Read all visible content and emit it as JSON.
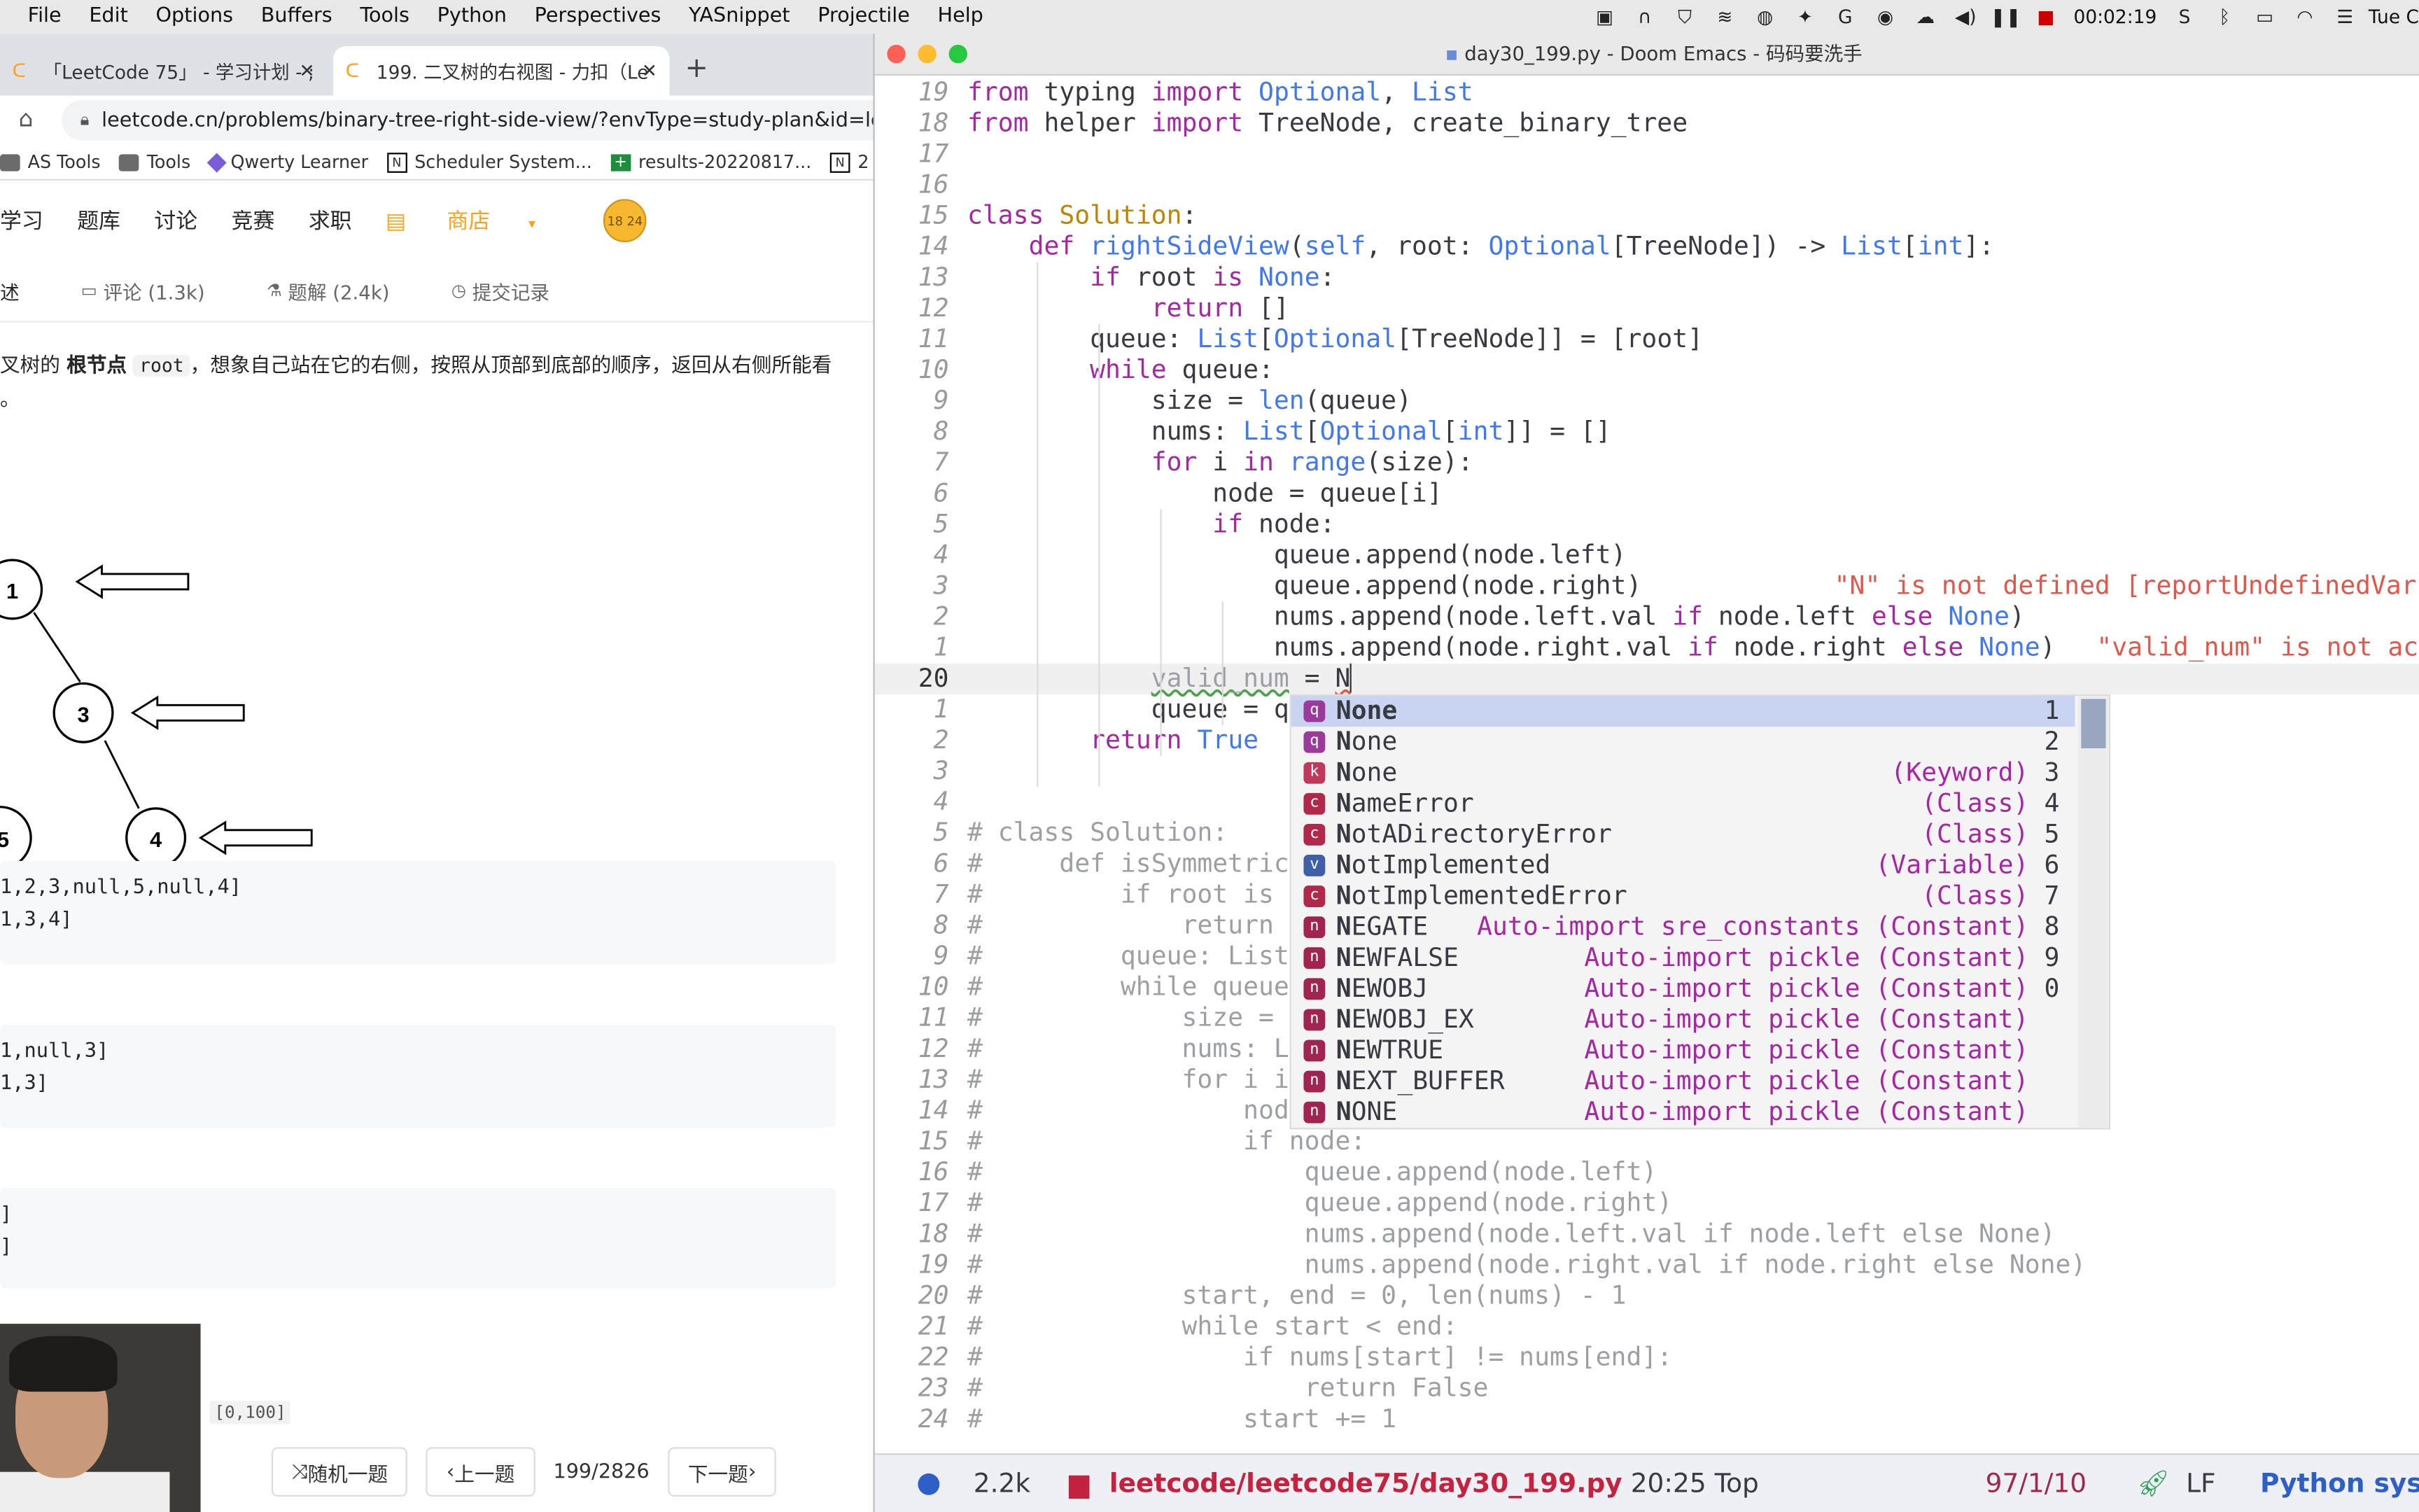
{
  "menubar": {
    "items": [
      "File",
      "Edit",
      "Options",
      "Buffers",
      "Tools",
      "Python",
      "Perspectives",
      "YASnippet",
      "Projectile",
      "Help"
    ],
    "timer": "00:02:19",
    "date": "Tue C"
  },
  "browser": {
    "tabs": [
      {
        "title": "「LeetCode 75」 - 学习计划 - ;"
      },
      {
        "title": "199. 二叉树的右视图 - 力扣（Le"
      }
    ],
    "url": "leetcode.cn/problems/binary-tree-right-side-view/?envType=study-plan&id=leetco",
    "bookmarks": [
      "AS Tools",
      "Tools",
      "Qwerty Learner",
      "Scheduler System...",
      "results-20220817...",
      "2"
    ],
    "nav": [
      "学习",
      "题库",
      "讨论",
      "竞赛",
      "求职",
      "商店"
    ],
    "coin_text": "18 24",
    "subtabs": [
      "述",
      "评论 (1.3k)",
      "题解 (2.4k)",
      "提交记录"
    ],
    "description": {
      "part1": "叉树的 ",
      "bold": "根节点",
      "code": "root",
      "part2": "，想象自己站在它的右侧，按照从顶部到底部的顺序，返回从右侧所能看",
      "part3": "。"
    },
    "tree_nodes": [
      "1",
      "3",
      "5",
      "4"
    ],
    "examples": [
      [
        "1,2,3,null,5,null,4]",
        "1,3,4]"
      ],
      [
        "1,null,3]",
        "1,3]"
      ],
      [
        "]",
        "]"
      ]
    ],
    "range": "[0,100]",
    "buttons": {
      "random": "随机一题",
      "prev": "上一题",
      "page": "199/2826",
      "next": "下一题"
    }
  },
  "emacs": {
    "title": "day30_199.py - Doom Emacs - 码码要洗手",
    "lines": [
      {
        "n": "19",
        "c": "from typing import Optional, List"
      },
      {
        "n": "18",
        "c": "from helper import TreeNode, create_binary_tree"
      },
      {
        "n": "17",
        "c": ""
      },
      {
        "n": "16",
        "c": ""
      },
      {
        "n": "15",
        "c": "class Solution:"
      },
      {
        "n": "14",
        "c": "    def rightSideView(self, root: Optional[TreeNode]) -> List[int]:"
      },
      {
        "n": "13",
        "c": "        if root is None:"
      },
      {
        "n": "12",
        "c": "            return []"
      },
      {
        "n": "11",
        "c": "        queue: List[Optional[TreeNode]] = [root]"
      },
      {
        "n": "10",
        "c": "        while queue:"
      },
      {
        "n": "9",
        "c": "            size = len(queue)"
      },
      {
        "n": "8",
        "c": "            nums: List[Optional[int]] = []"
      },
      {
        "n": "7",
        "c": "            for i in range(size):"
      },
      {
        "n": "6",
        "c": "                node = queue[i]"
      },
      {
        "n": "5",
        "c": "                if node:"
      },
      {
        "n": "4",
        "c": "                    queue.append(node.left)"
      },
      {
        "n": "3",
        "c": "                    queue.append(node.right)"
      },
      {
        "n": "2",
        "c": "                    nums.append(node.left.val if node.left else None)"
      },
      {
        "n": "1",
        "c": "                    nums.append(node.right.val if node.right else None)"
      },
      {
        "n": "20",
        "c": "            valid_num = N"
      },
      {
        "n": "1",
        "c": "            queue = q"
      },
      {
        "n": "2",
        "c": "        return True"
      },
      {
        "n": "3",
        "c": ""
      },
      {
        "n": "4",
        "c": ""
      },
      {
        "n": "5",
        "c": "# class Solution:"
      },
      {
        "n": "6",
        "c": "#     def isSymmetric"
      },
      {
        "n": "7",
        "c": "#         if root is"
      },
      {
        "n": "8",
        "c": "#             return"
      },
      {
        "n": "9",
        "c": "#         queue: List"
      },
      {
        "n": "10",
        "c": "#         while queue"
      },
      {
        "n": "11",
        "c": "#             size ="
      },
      {
        "n": "12",
        "c": "#             nums: L"
      },
      {
        "n": "13",
        "c": "#             for i i"
      },
      {
        "n": "14",
        "c": "#                 nod"
      },
      {
        "n": "15",
        "c": "#                 if node:"
      },
      {
        "n": "16",
        "c": "#                     queue.append(node.left)"
      },
      {
        "n": "17",
        "c": "#                     queue.append(node.right)"
      },
      {
        "n": "18",
        "c": "#                     nums.append(node.left.val if node.left else None)"
      },
      {
        "n": "19",
        "c": "#                     nums.append(node.right.val if node.right else None)"
      },
      {
        "n": "20",
        "c": "#             start, end = 0, len(nums) - 1"
      },
      {
        "n": "21",
        "c": "#             while start < end:"
      },
      {
        "n": "22",
        "c": "#                 if nums[start] != nums[end]:"
      },
      {
        "n": "23",
        "c": "#                     return False"
      },
      {
        "n": "24",
        "c": "#                 start += 1"
      }
    ],
    "diagnostics": [
      "\"N\" is not defined [reportUndefinedVar",
      "\"valid_num\" is not ac"
    ],
    "completions": [
      {
        "first": "N",
        "rest": "one",
        "detail": "",
        "num": "1",
        "icon": "q",
        "color": "#9b3a9b"
      },
      {
        "first": "N",
        "rest": "one",
        "detail": "",
        "num": "2",
        "icon": "q",
        "color": "#9b3a9b"
      },
      {
        "first": "N",
        "rest": "one",
        "detail": "(Keyword)",
        "num": "3",
        "icon": "k",
        "color": "#c0395c"
      },
      {
        "first": "N",
        "rest": "ameError",
        "detail": "(Class)",
        "num": "4",
        "icon": "c",
        "color": "#b0284a"
      },
      {
        "first": "N",
        "rest": "otADirectoryError",
        "detail": "(Class)",
        "num": "5",
        "icon": "c",
        "color": "#b0284a"
      },
      {
        "first": "N",
        "rest": "otImplemented",
        "detail": "(Variable)",
        "num": "6",
        "icon": "v",
        "color": "#3f5fa8"
      },
      {
        "first": "N",
        "rest": "otImplementedError",
        "detail": "(Class)",
        "num": "7",
        "icon": "c",
        "color": "#b0284a"
      },
      {
        "first": "N",
        "rest": "EGATE",
        "detail": "Auto-import sre_constants (Constant)",
        "num": "8",
        "icon": "n",
        "color": "#a0244f"
      },
      {
        "first": "N",
        "rest": "EWFALSE",
        "detail": "Auto-import pickle (Constant)",
        "num": "9",
        "icon": "n",
        "color": "#a0244f"
      },
      {
        "first": "N",
        "rest": "EWOBJ",
        "detail": "Auto-import pickle (Constant)",
        "num": "0",
        "icon": "n",
        "color": "#a0244f"
      },
      {
        "first": "N",
        "rest": "EWOBJ_EX",
        "detail": "Auto-import pickle (Constant)",
        "num": "",
        "icon": "n",
        "color": "#a0244f"
      },
      {
        "first": "N",
        "rest": "EWTRUE",
        "detail": "Auto-import pickle (Constant)",
        "num": "",
        "icon": "n",
        "color": "#a0244f"
      },
      {
        "first": "N",
        "rest": "EXT_BUFFER",
        "detail": "Auto-import pickle (Constant)",
        "num": "",
        "icon": "n",
        "color": "#a0244f"
      },
      {
        "first": "N",
        "rest": "ONE",
        "detail": "Auto-import pickle (Constant)",
        "num": "",
        "icon": "n",
        "color": "#a0244f"
      }
    ],
    "modeline": {
      "size": "2.2k",
      "path": "leetcode/leetcode75/day30_199.py",
      "position": "20:25 Top",
      "counts": "97/1/10",
      "eol": "LF",
      "mode": "Python syst"
    }
  }
}
